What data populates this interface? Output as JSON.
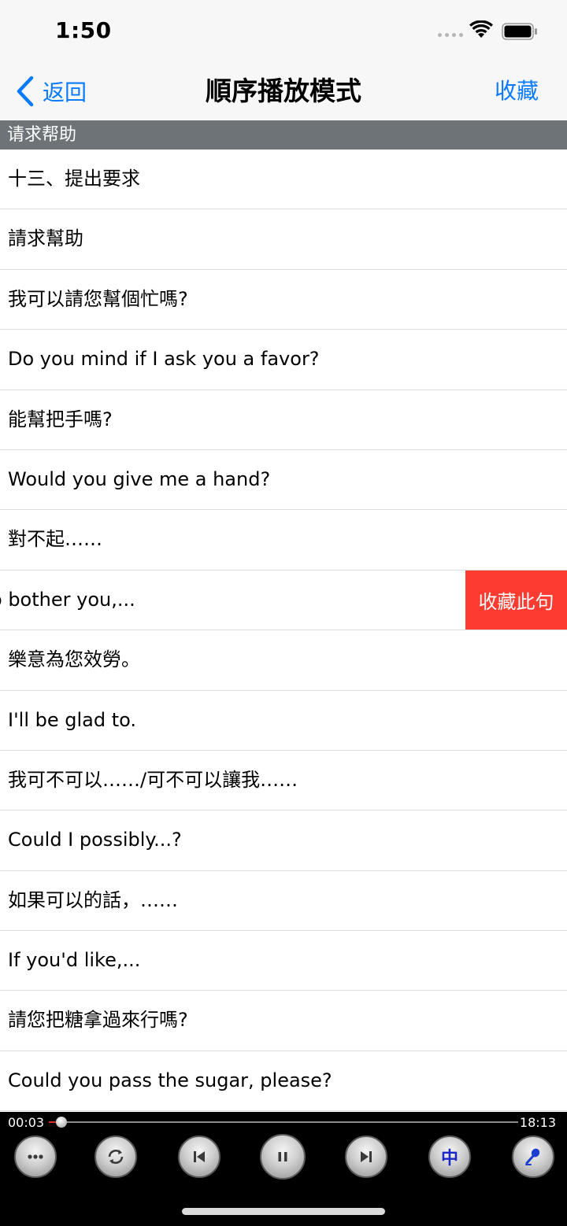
{
  "status_bar": {
    "time": "1:50"
  },
  "nav": {
    "back_label": "返回",
    "title": "順序播放模式",
    "favorite_label": "收藏"
  },
  "section": {
    "header": "请求帮助"
  },
  "rows": [
    "十三、提出要求",
    "請求幫助",
    "我可以請您幫個忙嗎?",
    "Do you mind if I ask you a favor?",
    "能幫把手嗎?",
    "Would you give me a hand?",
    "對不起……",
    "o bother you,...",
    "樂意為您效勞。",
    "I'll be glad to.",
    "我可不可以……/可不可以讓我……",
    "Could I possibly...?",
    "如果可以的話，……",
    "If you'd like,...",
    "請您把糖拿過來行嗎?",
    "Could you pass the sugar, please?"
  ],
  "swipe_action": {
    "label": "收藏此句",
    "color": "#fe3b30"
  },
  "player": {
    "current_time": "00:03",
    "total_time": "18:13",
    "progress": 0.003,
    "lang_label": "中",
    "controls": [
      "more-icon",
      "repeat-icon",
      "previous-icon",
      "pause-icon",
      "next-icon",
      "language-toggle",
      "microphone-icon"
    ]
  },
  "colors": {
    "accent": "#0a7aff",
    "section_bg": "#6d7377",
    "player_bg": "#000000"
  }
}
